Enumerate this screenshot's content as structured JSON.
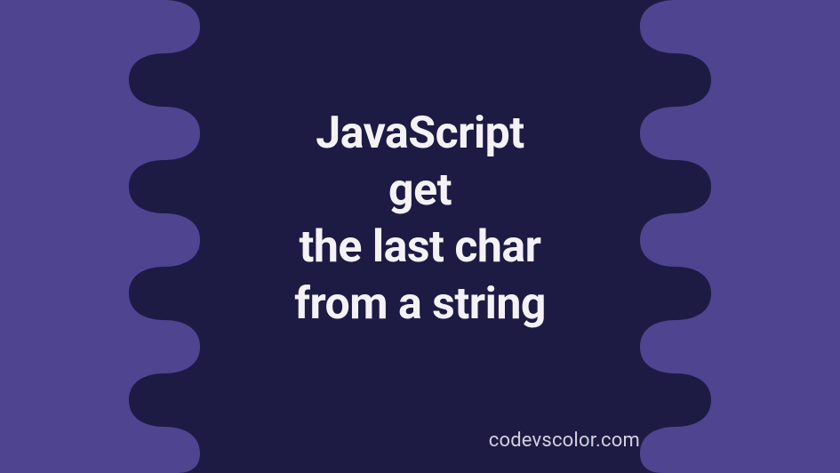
{
  "title": {
    "line1": "JavaScript",
    "line2": "get",
    "line3": "the last char",
    "line4": "from a string"
  },
  "footer": "codevscolor.com",
  "colors": {
    "background_light": "#4f4490",
    "background_dark": "#1d1b44",
    "text": "#f4f2f7",
    "footer_text": "#d4cfe0"
  }
}
